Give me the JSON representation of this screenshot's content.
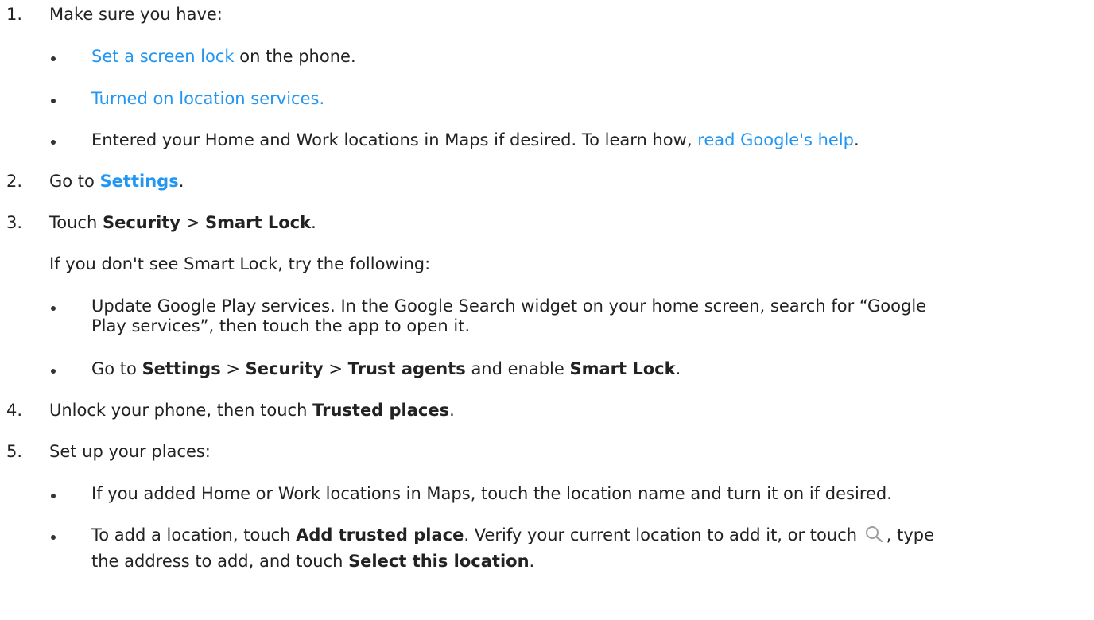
{
  "steps": {
    "s1": {
      "num": "1.",
      "text": "Make sure you have:"
    },
    "s1_b1": {
      "link": "Set a screen lock",
      "rest": " on the phone."
    },
    "s1_b2": {
      "link": "Turned on location services."
    },
    "s1_b3": {
      "text": "Entered your Home and Work locations in Maps if desired. To learn how, ",
      "link": "read Google's help",
      "end": "."
    },
    "s2": {
      "num": "2.",
      "pre": "Go to ",
      "link": "Settings",
      "end": "."
    },
    "s3": {
      "num": "3.",
      "pre": "Touch ",
      "b1": "Security",
      "sep": " > ",
      "b2": "Smart Lock",
      "end": "."
    },
    "s3_p": {
      "text": "If you don't see Smart Lock, try the following:"
    },
    "s3_b1": {
      "line1": "Update Google Play services. In the Google Search widget on your home screen, search for “Google",
      "line2": "Play services”, then touch the app to open it."
    },
    "s3_b2": {
      "pre": "Go to ",
      "b1": "Settings",
      "sep1": " > ",
      "b2": "Security",
      "sep2": " > ",
      "b3": "Trust agents",
      "mid": " and enable ",
      "b4": "Smart Lock",
      "end": "."
    },
    "s4": {
      "num": "4.",
      "pre": "Unlock your phone, then touch ",
      "b1": "Trusted places",
      "end": "."
    },
    "s5": {
      "num": "5.",
      "text": "Set up your places:"
    },
    "s5_b1": {
      "text": "If you added Home or Work locations in Maps, touch the location name and turn it on if desired."
    },
    "s5_b2": {
      "pre": "To add a location, touch ",
      "b1": "Add trusted place",
      "mid": ". Verify your current location to add it, or touch ",
      "after_icon": ", type",
      "line2_pre": "the address to add, and touch ",
      "b2": "Select this location",
      "end": "."
    }
  },
  "icons": {
    "search": "search-icon"
  },
  "colors": {
    "link": "#2196f3",
    "text": "#222222"
  }
}
